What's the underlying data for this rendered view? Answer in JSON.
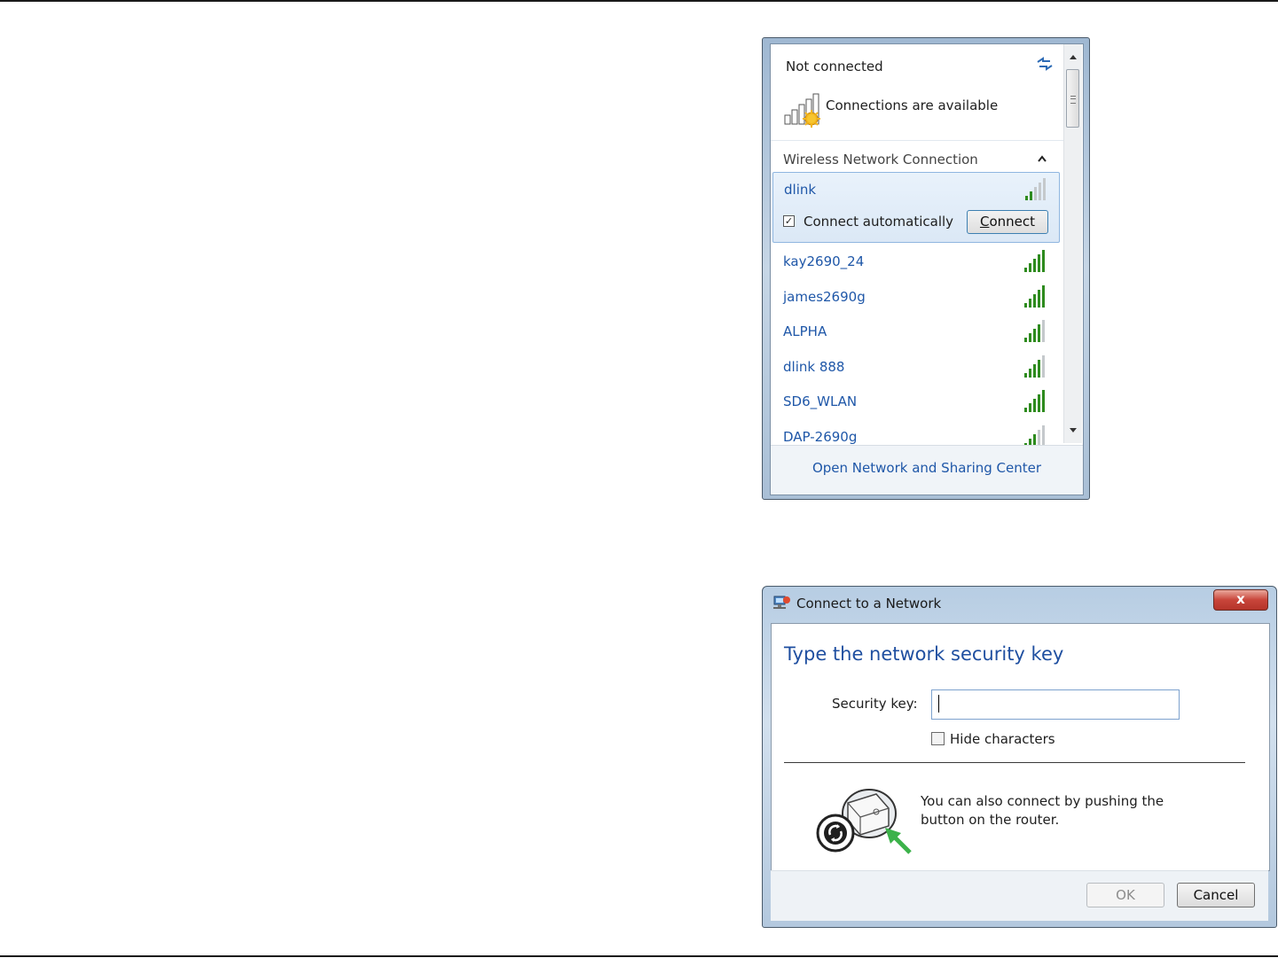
{
  "flyout": {
    "status": "Not connected",
    "availability": "Connections are available",
    "section_title": "Wireless Network Connection",
    "selected": {
      "name": "dlink",
      "auto_connect_checked": true,
      "auto_connect_label": "Connect automatically",
      "connect_button_accel": "C",
      "connect_button_rest": "onnect",
      "signal_bars": 2
    },
    "networks": [
      {
        "name": "kay2690_24",
        "signal_bars": 5
      },
      {
        "name": "james2690g",
        "signal_bars": 5
      },
      {
        "name": "ALPHA",
        "signal_bars": 4
      },
      {
        "name": "dlink 888",
        "signal_bars": 4
      },
      {
        "name": "SD6_WLAN",
        "signal_bars": 5
      },
      {
        "name": "DAP-2690g",
        "signal_bars": 3
      }
    ],
    "footer_link": "Open Network and Sharing Center",
    "colors": {
      "signal_on": "#2e8b1e",
      "signal_off": "#c5c9cc",
      "link": "#1f57a8"
    }
  },
  "dialog": {
    "title": "Connect to a Network",
    "close_glyph": "x",
    "heading": "Type the network security key",
    "key_label": "Security key:",
    "key_value": "",
    "hide_characters_label": "Hide characters",
    "hide_characters_checked": false,
    "wps_lines": [
      "You can also connect by pushing the",
      "button on the router."
    ],
    "ok_label": "OK",
    "cancel_label": "Cancel",
    "colors": {
      "heading": "#1f4fa0",
      "close": "#c8453a",
      "arrow": "#3cb24a"
    }
  }
}
